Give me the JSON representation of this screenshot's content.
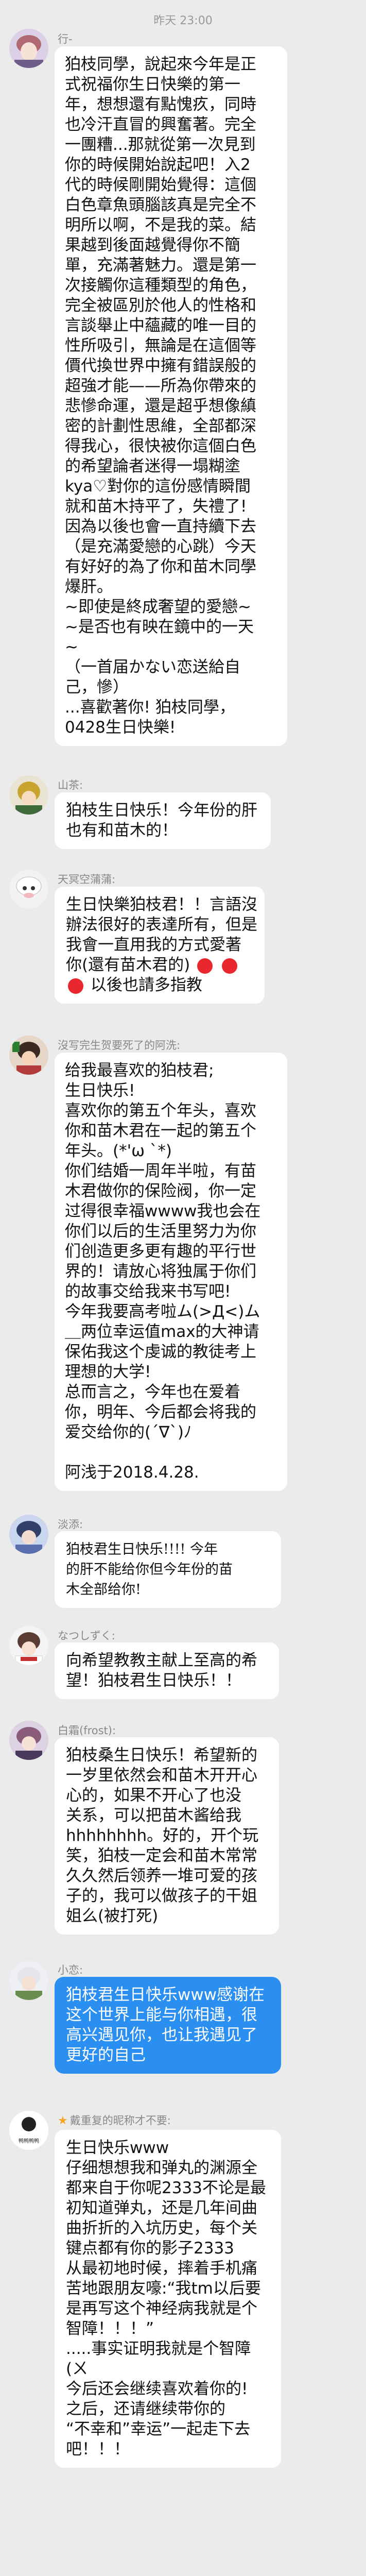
{
  "timestamp": "昨天 23:00",
  "messages": [
    {
      "sender": "行-",
      "lines": [
        "狛枝同學，說起來今年是正",
        "式祝福你生日快樂的第一",
        "年，想想還有點愧疚，同時",
        "也冷汗直冒的興奮著。完全",
        "一團糟...那就從第一次見到",
        "你的時候開始說起吧！入2",
        "代的時候剛開始覺得：這個",
        "白色章魚頭腦該真是完全不",
        "明所以啊，不是我的菜。結",
        "果越到後面越覺得你不簡",
        "單，充滿著魅力。還是第一",
        "次接觸你這種類型的角色，",
        "完全被區別於他人的性格和",
        "言談舉止中蘊藏的唯一目的",
        "性所吸引，無論是在這個等",
        "價代換世界中擁有錯誤般的",
        "超強才能——所為你帶來的",
        "悲慘命運，還是超乎想像縝",
        "密的計劃性思維，全部都深",
        "得我心，很快被你這個白色",
        "的希望論者迷得一塌糊塗",
        "kya♡對你的這份感情瞬間",
        "就和苗木持平了，失禮了!",
        "因為以後也會一直持續下去",
        "（是充滿愛戀的心跳）今天",
        "有好好的為了你和苗木同學",
        "爆肝。",
        "~即使是終成奢望的愛戀~",
        "~是否也有映在鏡中的一天",
        "~",
        "（一首届かない恋送給自",
        "己，慘）",
        "...喜歡著你! 狛枝同學，",
        "0428生日快樂!"
      ]
    },
    {
      "sender": "山茶:",
      "lines": [
        "狛枝生日快乐！今年份的肝",
        "也有和苗木的！"
      ]
    },
    {
      "sender": "天冥空蒲蒲:",
      "lines": [
        "生日快樂狛枝君！！言語沒",
        "辦法很好的表達所有，但是",
        "我會一直用我的方式愛著",
        "你(還有苗木君的)",
        "以後也請多指教"
      ],
      "hearts_on_line": 3,
      "star_line": 4
    },
    {
      "sender": "沒写完生贺要死了的阿洗:",
      "lines": [
        "给我最喜欢的狛枝君;",
        "生日快乐!",
        "喜欢你的第五个年头，喜欢",
        "你和苗木君在一起的第五个",
        "年头。(*'ω ˋ*)",
        "你们结婚一周年半啦，有苗",
        "木君做你的保险阀，你一定",
        "过得很幸福wwww我也会在",
        "你们以后的生活里努力为你",
        "们创造更多更有趣的平行世",
        "界的！请放心将独属于你们",
        "的故事交给我来书写吧!",
        "今年我要高考啦ム(>Д<)ム",
        "＿两位幸运值max的大神请",
        "保佑我这个虔诚的教徒考上",
        "理想的大学!",
        "总而言之，今年也在爱着",
        "你，明年、今后都会将我的",
        "爱交给你的(´∇`)ﾉ",
        "",
        "阿浅于2018.4.28."
      ]
    },
    {
      "sender": "淡添:",
      "lines": [
        "狛枝君生日快乐!!!! 今年",
        "的肝不能给你但今年份的苗",
        "木全部给你!"
      ],
      "styled": true
    },
    {
      "sender": "なつしずく:",
      "lines": [
        "向希望教教主献上至高的希",
        "望！狛枝君生日快乐！！"
      ]
    },
    {
      "sender": "白霜(frost):",
      "lines": [
        "狛枝桑生日快乐！希望新的",
        "一岁里依然会和苗木开开心",
        "心的，如果不开心了也没",
        "关系，可以把苗木酱给我",
        "hhhhhhhh。好的，开个玩",
        "笑，狛枝一定会和苗木常常",
        "久久然后领养一堆可爱的孩",
        "子的，我可以做孩子的干姐",
        "姐么(被打死)"
      ]
    },
    {
      "sender": "小恋:",
      "lines": [
        "狛枝君生日快乐www感谢在",
        "这个世界上能与你相遇，很",
        "高兴遇见你，也让我遇见了",
        "更好的自己"
      ],
      "blue": true
    },
    {
      "sender": "戴重复的昵称才不要:",
      "avatar_text": "鸭鸭鸭鸭",
      "lines": [
        "生日快乐www",
        "仔细想想我和弹丸的渊源全",
        "都来自于你呢2333不论是最",
        "初知道弹丸，还是几年间曲",
        "曲折折的入坑历史，每个关",
        "键点都有你的影子2333",
        "从最初地时候，摔着手机痛",
        "苦地跟朋友嚎:“我tm以后要",
        "是再写这个神经病我就是个",
        "智障！！！”",
        ".....事实证明我就是个智障",
        "(ㄨ",
        "今后还会继续喜欢着你的!",
        "之后，还请继续带你的",
        "“不幸和”幸运”一起走下去",
        "吧！！！"
      ],
      "badge": true
    }
  ]
}
